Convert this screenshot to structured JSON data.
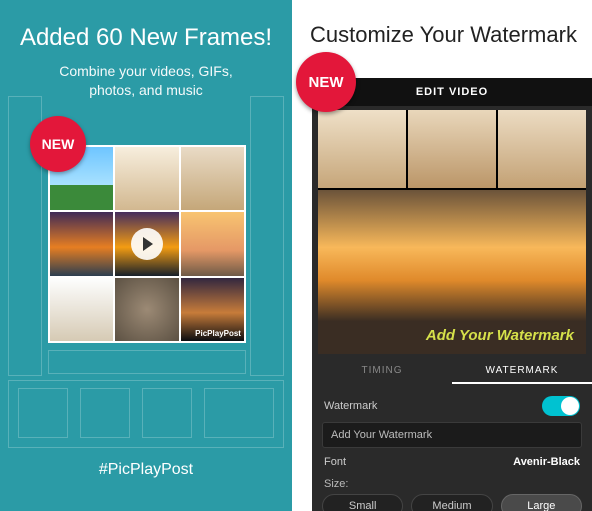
{
  "left": {
    "title": "Added 60 New Frames!",
    "subtitle_line1": "Combine your videos, GIFs,",
    "subtitle_line2": "photos, and music",
    "new_badge": "NEW",
    "collage_watermark": "PicPlayPost",
    "hashtag": "#PicPlayPost"
  },
  "right": {
    "title": "Customize Your Watermark",
    "new_badge": "NEW",
    "edit_bar": "EDIT VIDEO",
    "preview_watermark": "Add Your Watermark",
    "tabs": {
      "timing": "TIMING",
      "watermark": "WATERMARK"
    },
    "settings": {
      "watermark_label": "Watermark",
      "watermark_input": "Add Your Watermark",
      "font_label": "Font",
      "font_value": "Avenir-Black",
      "size_label": "Size:",
      "size_small": "Small",
      "size_medium": "Medium",
      "size_large": "Large"
    }
  }
}
